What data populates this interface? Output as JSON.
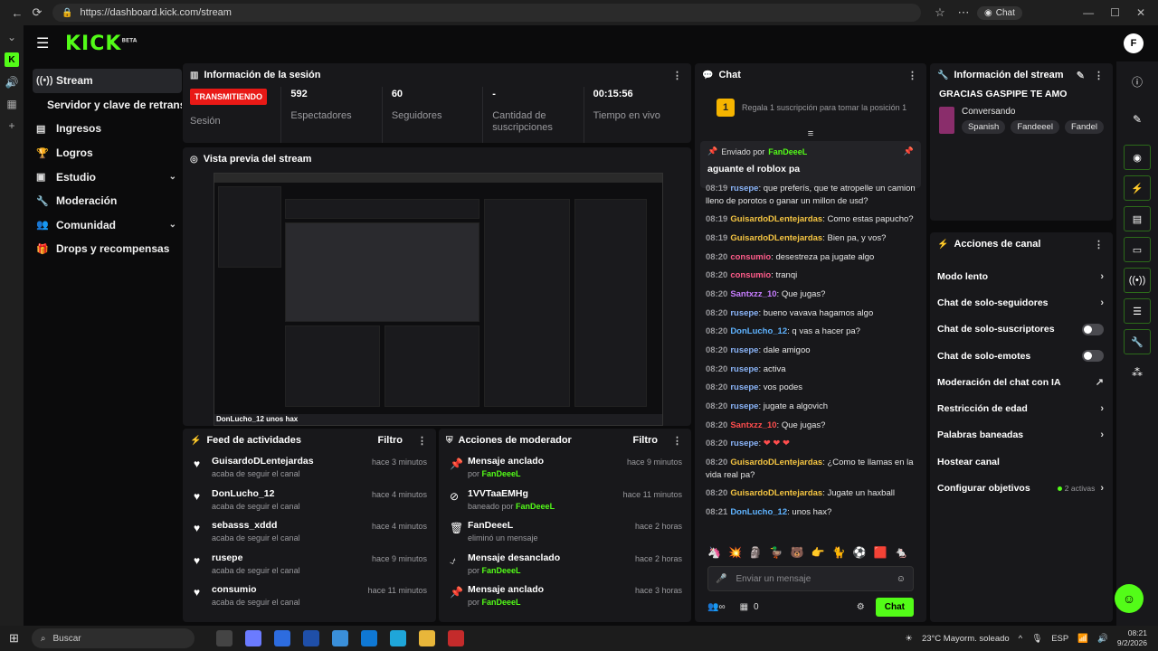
{
  "browser": {
    "url": "https://dashboard.kick.com/stream",
    "chat_label": "Chat"
  },
  "app": {
    "logo": "KICK",
    "logo_tag": "BETA"
  },
  "sidebar": {
    "items": [
      {
        "label": "Stream",
        "icon": "broadcast-icon"
      },
      {
        "label": "Servidor y clave de retransmisión",
        "icon": ""
      },
      {
        "label": "Ingresos",
        "icon": "dollar-icon"
      },
      {
        "label": "Logros",
        "icon": "trophy-icon"
      },
      {
        "label": "Estudio",
        "icon": "studio-icon"
      },
      {
        "label": "Moderación",
        "icon": "wrench-icon"
      },
      {
        "label": "Comunidad",
        "icon": "people-icon"
      },
      {
        "label": "Drops y recompensas",
        "icon": "gift-icon"
      }
    ]
  },
  "session": {
    "title": "Información de la sesión",
    "live_badge": "TRANSMITIENDO",
    "session_label": "Sesión",
    "stats": [
      {
        "value": "592",
        "label": "Espectadores"
      },
      {
        "value": "60",
        "label": "Seguidores"
      },
      {
        "value": "-",
        "label": "Cantidad de suscripciones"
      },
      {
        "value": "00:15:56",
        "label": "Tiempo en vivo"
      }
    ]
  },
  "preview": {
    "title": "Vista previa del stream",
    "caption": "DonLucho_12  unos hax"
  },
  "feed": {
    "title": "Feed de actividades",
    "filter": "Filtro",
    "items": [
      {
        "name": "GuisardoDLentejardas",
        "sub": "acaba de seguir el canal",
        "time": "hace 3 minutos"
      },
      {
        "name": "DonLucho_12",
        "sub": "acaba de seguir el canal",
        "time": "hace 4 minutos"
      },
      {
        "name": "sebasss_xddd",
        "sub": "acaba de seguir el canal",
        "time": "hace 4 minutos"
      },
      {
        "name": "rusepe",
        "sub": "acaba de seguir el canal",
        "time": "hace 9 minutos"
      },
      {
        "name": "consumio",
        "sub": "acaba de seguir el canal",
        "time": "hace 11 minutos"
      }
    ]
  },
  "mod": {
    "title": "Acciones de moderador",
    "filter": "Filtro",
    "items": [
      {
        "name": "Mensaje anclado",
        "pre": "por ",
        "by": "FanDeeeL",
        "time": "hace 9 minutos",
        "icon": "pin-icon"
      },
      {
        "name": "1VVTaaEMHg",
        "pre": "baneado por ",
        "by": "FanDeeeL",
        "time": "hace 11 minutos",
        "icon": "ban-icon"
      },
      {
        "name": "FanDeeeL",
        "pre": "eliminó un mensaje",
        "by": "",
        "time": "hace 2 horas",
        "icon": "trash-icon"
      },
      {
        "name": "Mensaje desanclado",
        "pre": "por ",
        "by": "FanDeeeL",
        "time": "hace 2 horas",
        "icon": "unpin-icon"
      },
      {
        "name": "Mensaje anclado",
        "pre": "por ",
        "by": "FanDeeeL",
        "time": "hace 3 horas",
        "icon": "pin-icon"
      }
    ]
  },
  "chat": {
    "title": "Chat",
    "gift_text": "Regala 1 suscripción para tomar la posición 1",
    "gift_rank": "1",
    "pinned_by_label": "Enviado por",
    "pinned_user": "FanDeeeL",
    "pinned_msg": "aguante el roblox pa",
    "messages": [
      {
        "time": "08:19",
        "user": "rusepe",
        "color": "#8ab4f8",
        "text": "que preferís, que te atropelle un camion lleno de porotos o ganar un millon de usd?"
      },
      {
        "time": "08:19",
        "user": "GuisardoDLentejardas",
        "color": "#f5c542",
        "text": "Como estas papucho?"
      },
      {
        "time": "08:19",
        "user": "GuisardoDLentejardas",
        "color": "#f5c542",
        "text": "Bien pa, y vos?"
      },
      {
        "time": "08:20",
        "user": "consumio",
        "color": "#ff5c8a",
        "text": "desestreza pa jugate algo"
      },
      {
        "time": "08:20",
        "user": "consumio",
        "color": "#ff5c8a",
        "text": "tranqi"
      },
      {
        "time": "08:20",
        "user": "Santxzz_10",
        "color": "#c77dff",
        "text": "Que jugas?"
      },
      {
        "time": "08:20",
        "user": "rusepe",
        "color": "#8ab4f8",
        "text": "bueno vavava hagamos algo"
      },
      {
        "time": "08:20",
        "user": "DonLucho_12",
        "color": "#5fb3ff",
        "text": "q vas a hacer pa?"
      },
      {
        "time": "08:20",
        "user": "rusepe",
        "color": "#8ab4f8",
        "text": "dale amigoo"
      },
      {
        "time": "08:20",
        "user": "rusepe",
        "color": "#8ab4f8",
        "text": "activa"
      },
      {
        "time": "08:20",
        "user": "rusepe",
        "color": "#8ab4f8",
        "text": "vos podes"
      },
      {
        "time": "08:20",
        "user": "rusepe",
        "color": "#8ab4f8",
        "text": "jugate a algovich"
      },
      {
        "time": "08:20",
        "user": "Santxzz_10",
        "color": "#ff4d4d",
        "text": "Que jugas?"
      },
      {
        "time": "08:20",
        "user": "rusepe",
        "color": "#8ab4f8",
        "text": "❤ ❤ ❤"
      },
      {
        "time": "08:20",
        "user": "GuisardoDLentejardas",
        "color": "#f5c542",
        "text": "¿Como te llamas en la vida real pa?"
      },
      {
        "time": "08:20",
        "user": "GuisardoDLentejardas",
        "color": "#f5c542",
        "text": "Jugate un haxball"
      },
      {
        "time": "08:21",
        "user": "DonLucho_12",
        "color": "#5fb3ff",
        "text": "unos hax?"
      }
    ],
    "input_placeholder": "Enviar un mensaje",
    "count": "0",
    "send_label": "Chat"
  },
  "stream_info": {
    "title": "Información del stream",
    "stream_title": "GRACIAS GASPIPE TE AMO",
    "category": "Conversando",
    "tags": [
      "Spanish",
      "Fandeeel",
      "Fandel"
    ]
  },
  "actions": {
    "title": "Acciones de canal",
    "items": [
      {
        "label": "Modo lento",
        "kind": "chevron"
      },
      {
        "label": "Chat de solo-seguidores",
        "kind": "chevron"
      },
      {
        "label": "Chat de solo-suscriptores",
        "kind": "toggle"
      },
      {
        "label": "Chat de solo-emotes",
        "kind": "toggle"
      },
      {
        "label": "Moderación del chat con IA",
        "kind": "external"
      },
      {
        "label": "Restricción de edad",
        "kind": "chevron"
      },
      {
        "label": "Palabras baneadas",
        "kind": "chevron"
      },
      {
        "label": "Hostear canal",
        "kind": "none"
      },
      {
        "label": "Configurar objetivos",
        "kind": "objetivos",
        "extra": "2 activas"
      }
    ]
  },
  "taskbar": {
    "search": "Buscar",
    "weather": "23°C  Mayorm. soleado",
    "lang": "ESP",
    "time": "08:21",
    "date": "9/2/2026"
  }
}
